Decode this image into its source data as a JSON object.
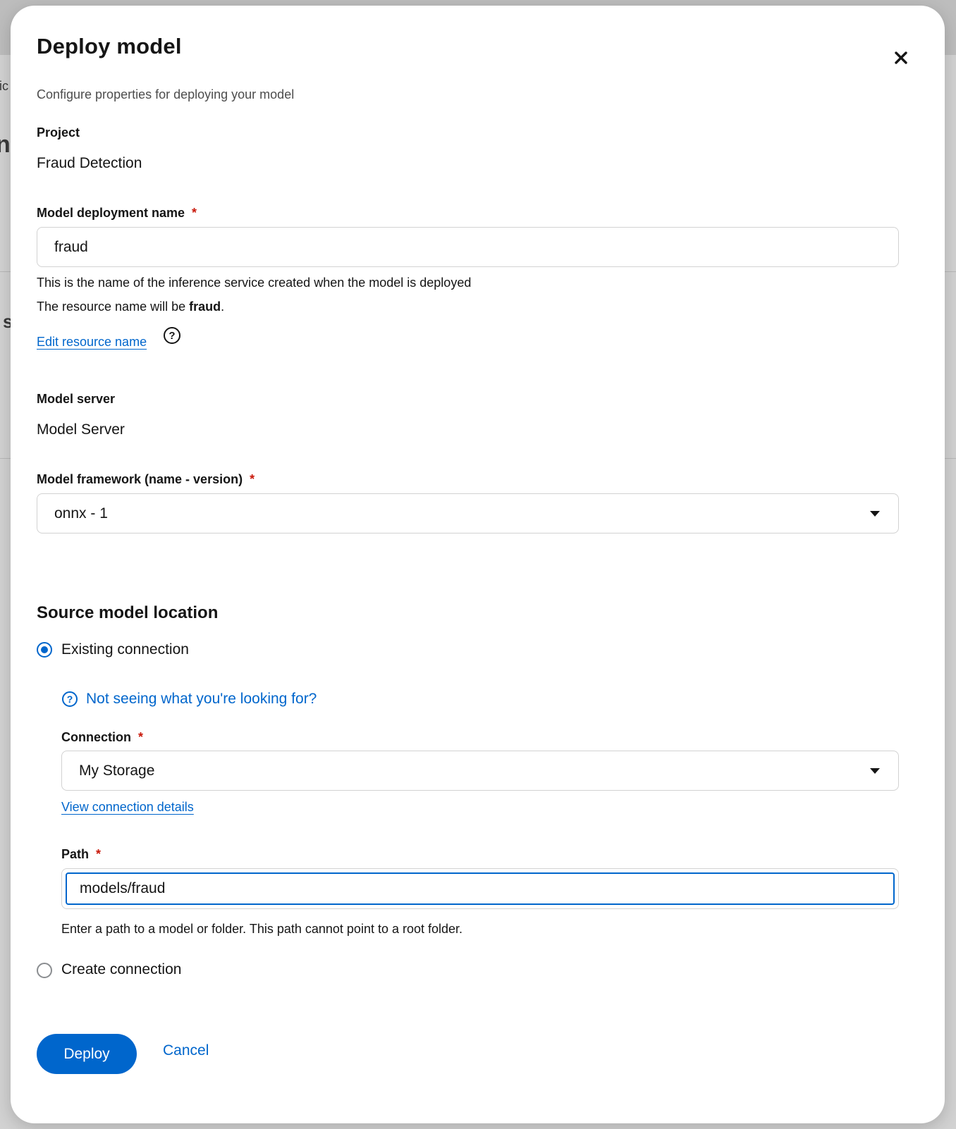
{
  "background": {
    "fragments": [
      "tic",
      "n",
      "s"
    ]
  },
  "modal": {
    "title": "Deploy model",
    "description": "Configure properties for deploying your model",
    "close_icon": "close-icon"
  },
  "project": {
    "label": "Project",
    "value": "Fraud Detection"
  },
  "deployment_name": {
    "label": "Model deployment name",
    "required_mark": "*",
    "value": "fraud",
    "helper": "This is the name of the inference service created when the model is deployed",
    "resource_prefix": "The resource name will be ",
    "resource_name": "fraud",
    "resource_suffix": ".",
    "edit_link": "Edit resource name",
    "help_icon": "help-icon"
  },
  "model_server": {
    "label": "Model server",
    "value": "Model Server"
  },
  "framework": {
    "label": "Model framework (name - version)",
    "required_mark": "*",
    "selected": "onnx - 1"
  },
  "source": {
    "title": "Source model location",
    "existing_label": "Existing connection",
    "not_seeing": "Not seeing what you're looking for?",
    "connection_label": "Connection",
    "connection_required": "*",
    "connection_selected": "My Storage",
    "view_details": "View connection details",
    "path_label": "Path",
    "path_required": "*",
    "path_value": "models/fraud",
    "path_helper": "Enter a path to a model or folder. This path cannot point to a root folder.",
    "create_label": "Create connection"
  },
  "actions": {
    "deploy": "Deploy",
    "cancel": "Cancel"
  },
  "colors": {
    "accent": "#0066cc",
    "required": "#c9190b"
  }
}
